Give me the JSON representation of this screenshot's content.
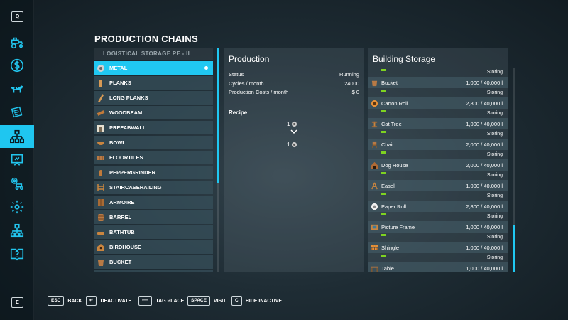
{
  "sidebar": {
    "top_key": "Q",
    "bottom_key": "E",
    "items": [
      {
        "icon": "tractor-icon"
      },
      {
        "icon": "dollar-icon"
      },
      {
        "icon": "cow-icon"
      },
      {
        "icon": "newspaper-icon"
      },
      {
        "icon": "production-chain-icon",
        "active": true
      },
      {
        "icon": "presentation-icon"
      },
      {
        "icon": "vehicles-settings-icon"
      },
      {
        "icon": "gear-icon"
      },
      {
        "icon": "hierarchy-icon"
      },
      {
        "icon": "help-book-icon"
      }
    ]
  },
  "page": {
    "title": "PRODUCTION CHAINS"
  },
  "chains": {
    "header": "LOGISTICAL STORAGE PE    - II",
    "items": [
      {
        "label": "METAL",
        "icon": "metal-roll-icon",
        "selected": true
      },
      {
        "label": "PLANKS",
        "icon": "planks-icon"
      },
      {
        "label": "LONG PLANKS",
        "icon": "long-planks-icon"
      },
      {
        "label": "WOODBEAM",
        "icon": "woodbeam-icon"
      },
      {
        "label": "PREFABWALL",
        "icon": "prefabwall-icon"
      },
      {
        "label": "BOWL",
        "icon": "bowl-icon"
      },
      {
        "label": "FLOORTILES",
        "icon": "floortiles-icon"
      },
      {
        "label": "PEPPERGRINDER",
        "icon": "peppergrinder-icon"
      },
      {
        "label": "STAIRCASERAILING",
        "icon": "railing-icon"
      },
      {
        "label": "ARMOIRE",
        "icon": "armoire-icon"
      },
      {
        "label": "BARREL",
        "icon": "barrel-icon"
      },
      {
        "label": "BATHTUB",
        "icon": "bathtub-icon"
      },
      {
        "label": "BIRDHOUSE",
        "icon": "birdhouse-icon"
      },
      {
        "label": "BUCKET",
        "icon": "bucket-icon"
      },
      {
        "label": "",
        "icon": "partial-item-icon"
      }
    ]
  },
  "production": {
    "title": "Production",
    "rows": [
      {
        "label": "Status",
        "value": "Running"
      },
      {
        "label": "Cycles / month",
        "value": "24000"
      },
      {
        "label": "Production Costs / month",
        "value": "$ 0"
      }
    ],
    "recipe_title": "Recipe",
    "recipe_input": "1",
    "recipe_output": "1"
  },
  "storage": {
    "title": "Building Storage",
    "items": [
      {
        "name": "Bucket",
        "amount": "1,000  /  40,000 l",
        "status": "Storing",
        "icon": "bucket-icon"
      },
      {
        "name": "Carton Roll",
        "amount": "2,800  /  40,000 l",
        "status": "Storing",
        "icon": "carton-roll-icon"
      },
      {
        "name": "Cat Tree",
        "amount": "1,000  /  40,000 l",
        "status": "Storing",
        "icon": "cat-tree-icon"
      },
      {
        "name": "Chair",
        "amount": "2,000  /  40,000 l",
        "status": "Storing",
        "icon": "chair-icon"
      },
      {
        "name": "Dog House",
        "amount": "2,000  /  40,000 l",
        "status": "Storing",
        "icon": "dog-house-icon"
      },
      {
        "name": "Easel",
        "amount": "1,000  /  40,000 l",
        "status": "Storing",
        "icon": "easel-icon"
      },
      {
        "name": "Paper Roll",
        "amount": "2,800  /  40,000 l",
        "status": "Storing",
        "icon": "paper-roll-icon"
      },
      {
        "name": "Picture Frame",
        "amount": "1,000  /  40,000 l",
        "status": "Storing",
        "icon": "picture-frame-icon"
      },
      {
        "name": "Shingle",
        "amount": "1,000  /  40,000 l",
        "status": "Storing",
        "icon": "shingle-icon"
      },
      {
        "name": "Table",
        "amount": "1,000  /  40,000 l",
        "status": "",
        "icon": "table-icon"
      }
    ],
    "top_status": "Storing"
  },
  "hints": [
    {
      "key": "ESC",
      "label": "BACK"
    },
    {
      "key": "↵",
      "label": "DEACTIVATE"
    },
    {
      "key": "⟵",
      "label": "TAG PLACE"
    },
    {
      "key": "SPACE",
      "label": "VISIT"
    },
    {
      "key": "C",
      "label": "HIDE INACTIVE"
    }
  ],
  "colors": {
    "accent": "#20c8f2",
    "fill_bar": "#7ed321"
  }
}
